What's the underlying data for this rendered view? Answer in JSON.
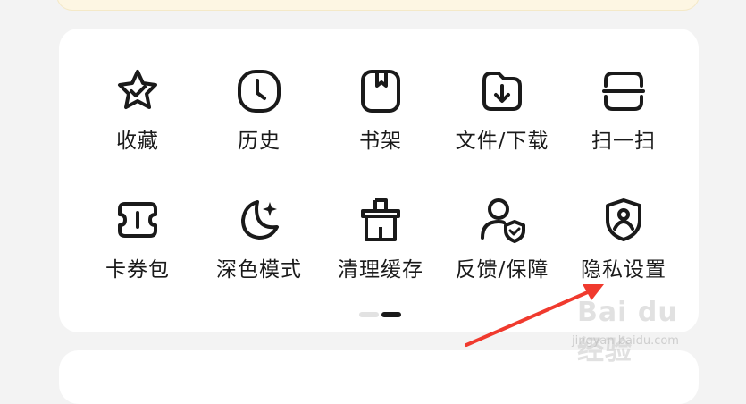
{
  "menu": {
    "items": [
      {
        "id": "favorites",
        "label": "收藏",
        "icon": "star-check-icon"
      },
      {
        "id": "history",
        "label": "历史",
        "icon": "clock-icon"
      },
      {
        "id": "bookshelf",
        "label": "书架",
        "icon": "bookmark-book-icon"
      },
      {
        "id": "files",
        "label": "文件/下载",
        "icon": "folder-download-icon"
      },
      {
        "id": "scan",
        "label": "扫一扫",
        "icon": "scan-icon"
      },
      {
        "id": "card-voucher",
        "label": "卡券包",
        "icon": "ticket-icon"
      },
      {
        "id": "dark-mode",
        "label": "深色模式",
        "icon": "moon-star-icon"
      },
      {
        "id": "clear-cache",
        "label": "清理缓存",
        "icon": "broom-icon"
      },
      {
        "id": "feedback",
        "label": "反馈/保障",
        "icon": "user-shield-icon"
      },
      {
        "id": "privacy",
        "label": "隐私设置",
        "icon": "shield-user-icon"
      }
    ]
  },
  "pager": {
    "pages": 2,
    "current": 2
  },
  "colors": {
    "icon": "#1a1a1a",
    "arrow": "#f03a2e",
    "background": "#f3f3f3",
    "card": "#ffffff"
  },
  "watermark": {
    "logo": "Bai du 经验",
    "url": "jingyan.baidu.com"
  }
}
